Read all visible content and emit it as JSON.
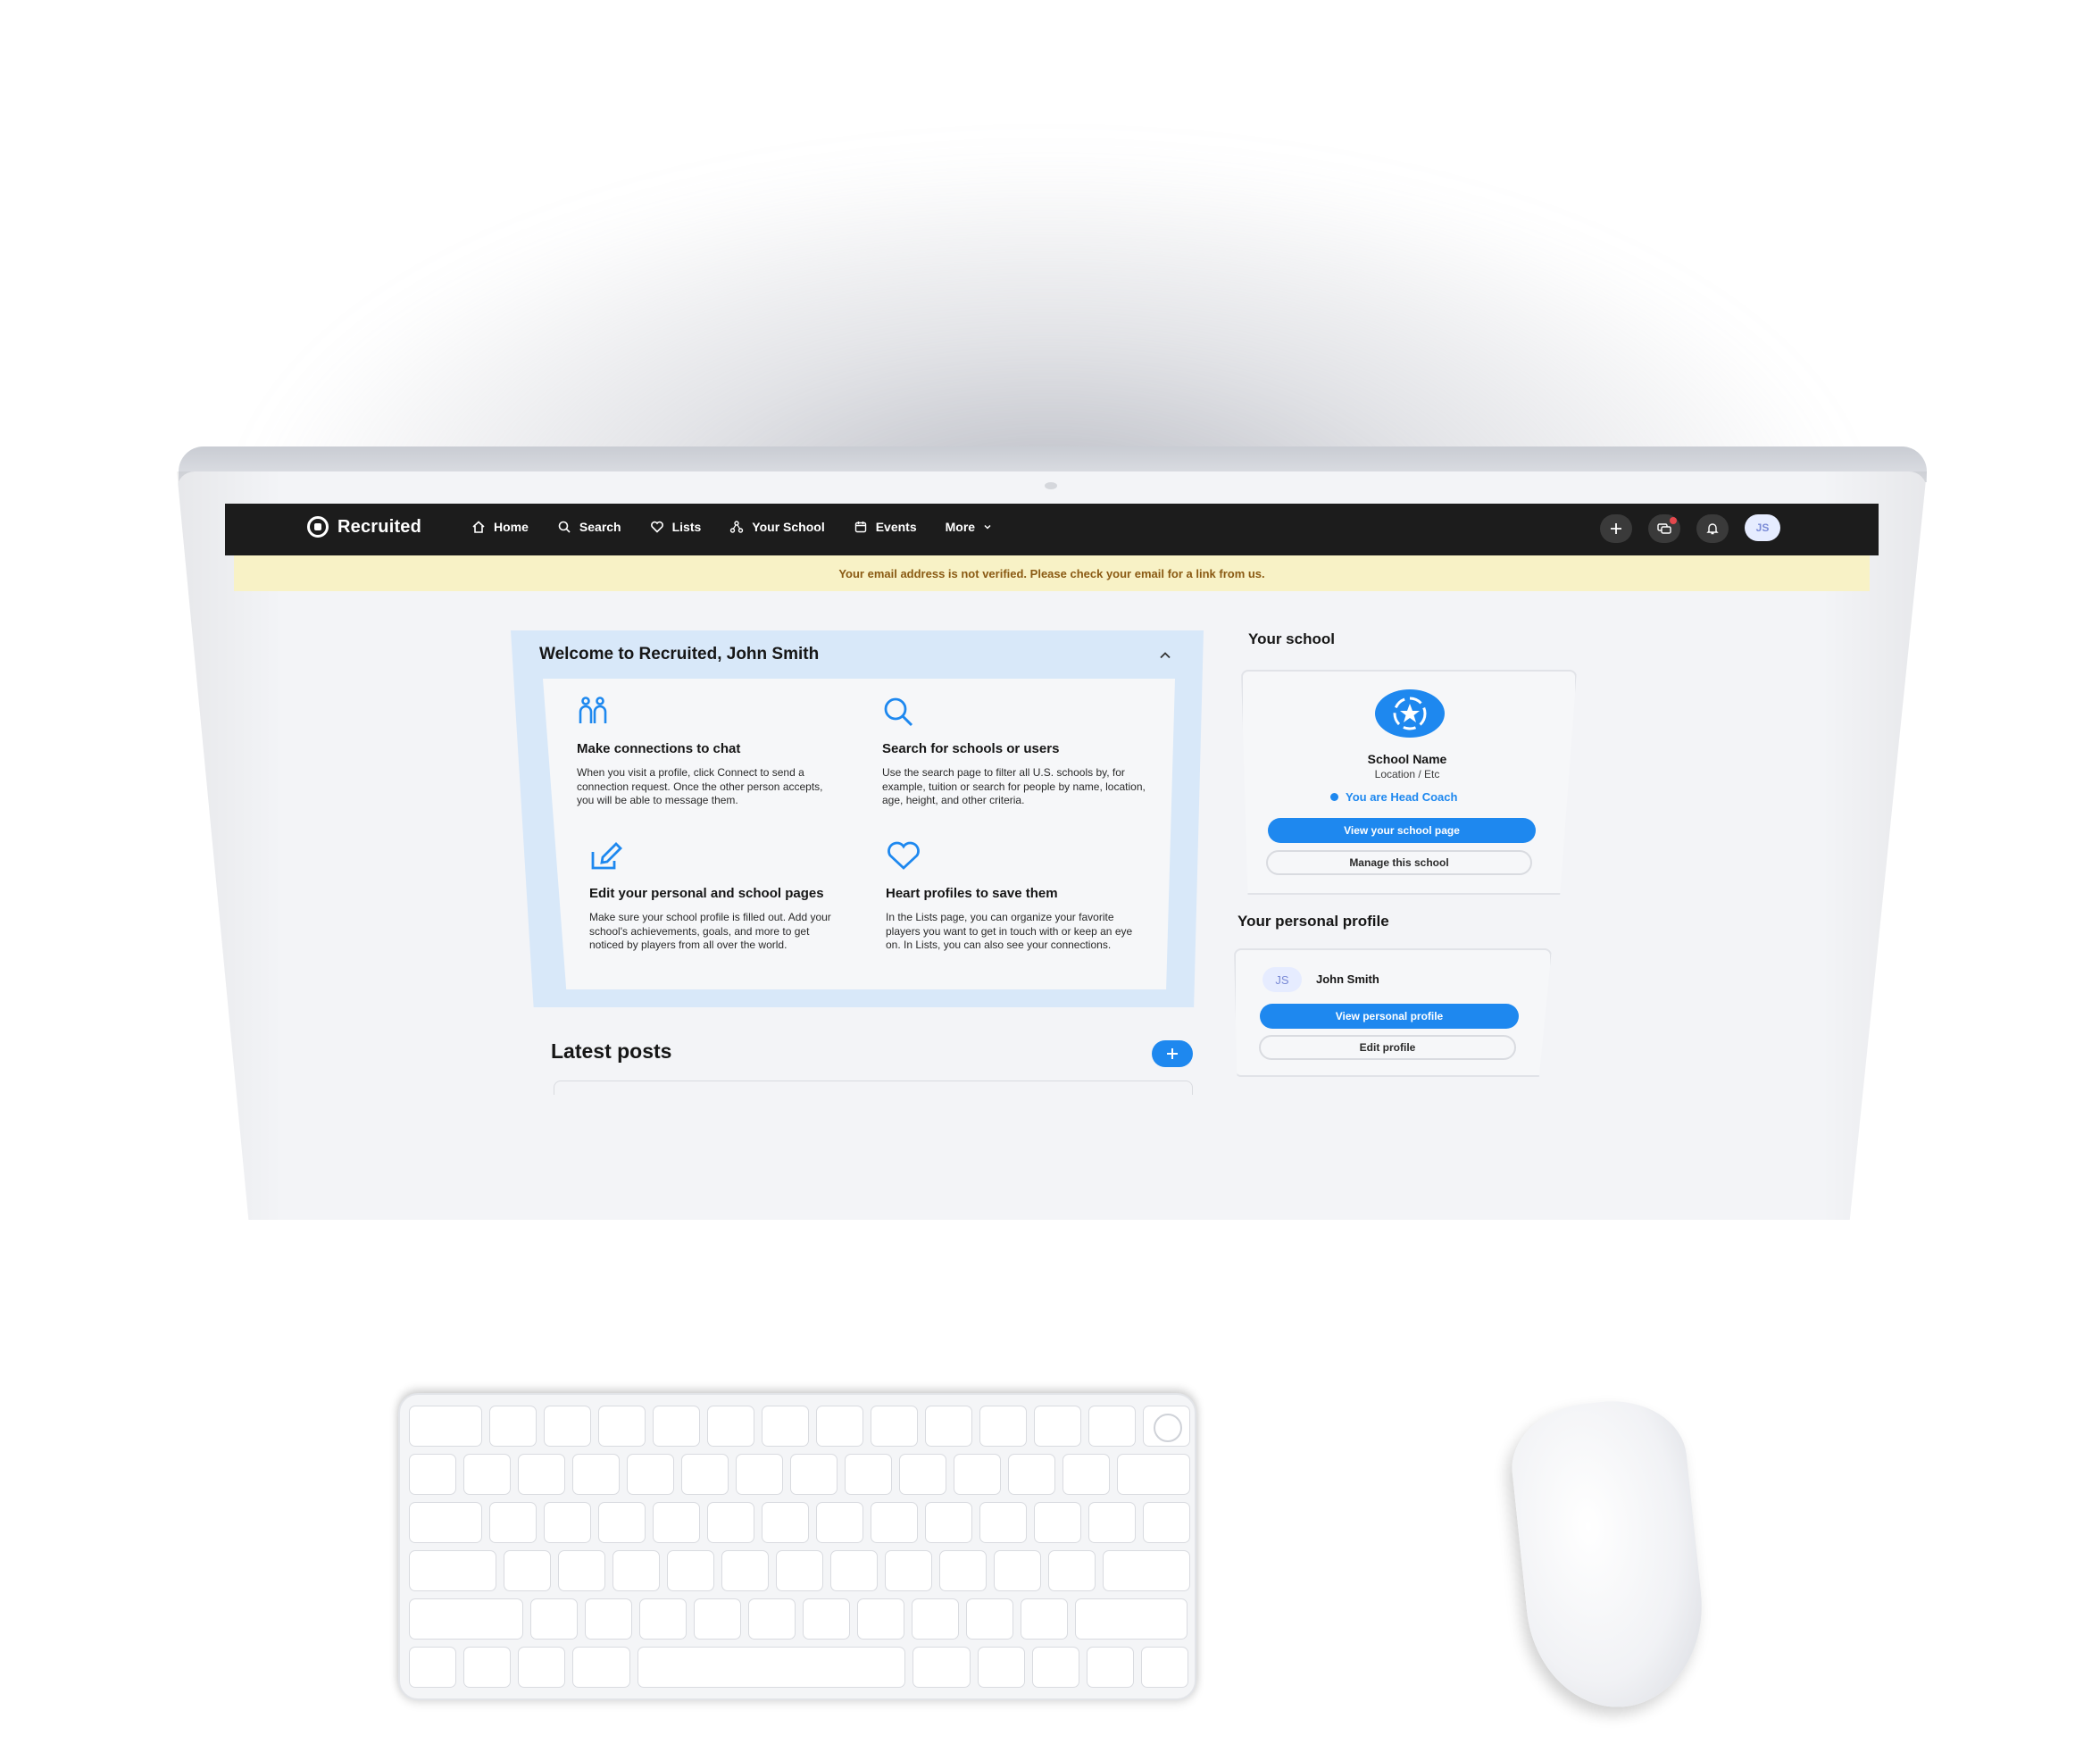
{
  "app": {
    "brand": "Recruited",
    "colors": {
      "accent": "#1e88ef",
      "navbar": "#1c1c1c",
      "banner": "#f8f2c6",
      "welcome_bg": "#d8e8f9"
    }
  },
  "navbar": {
    "items": [
      {
        "label": "Home",
        "icon": "home-icon"
      },
      {
        "label": "Search",
        "icon": "search-icon"
      },
      {
        "label": "Lists",
        "icon": "heart-icon"
      },
      {
        "label": "Your School",
        "icon": "school-icon"
      },
      {
        "label": "Events",
        "icon": "calendar-icon"
      },
      {
        "label": "More",
        "icon": "chevron-down-icon"
      }
    ],
    "right": [
      {
        "icon": "plus-icon"
      },
      {
        "icon": "chat-icon",
        "badge": true
      },
      {
        "icon": "bell-icon"
      }
    ],
    "avatar_initials": "JS"
  },
  "banner": {
    "text": "Your email address is not verified. Please check your email for a link from us."
  },
  "welcome": {
    "title": "Welcome to Recruited, John Smith",
    "features": [
      {
        "icon": "people-icon",
        "title": "Make connections to chat",
        "desc": "When you visit a profile, click Connect to send a connection request. Once the other person accepts, you will be able to message them."
      },
      {
        "icon": "search-icon",
        "title": "Search for schools or users",
        "desc": "Use the search page to filter all U.S. schools by, for example, tuition or search for people by name, location, age, height, and other criteria."
      },
      {
        "icon": "edit-icon",
        "title": "Edit your personal and school pages",
        "desc": "Make sure your school profile is filled out. Add your school's achievements, goals, and more to get noticed by players from all over the world."
      },
      {
        "icon": "heart-icon",
        "title": "Heart profiles to save them",
        "desc": "In the Lists page, you can organize your favorite players you want to get in touch with or keep an eye on. In Lists, you can also see your connections."
      }
    ]
  },
  "posts": {
    "title": "Latest posts"
  },
  "school": {
    "section_title": "Your school",
    "name": "School Name",
    "location": "Location / Etc",
    "role": "You are Head Coach",
    "view_button": "View your school page",
    "manage_button": "Manage this school"
  },
  "profile": {
    "section_title": "Your personal profile",
    "initials": "JS",
    "name": "John Smith",
    "view_button": "View personal profile",
    "edit_button": "Edit profile"
  }
}
